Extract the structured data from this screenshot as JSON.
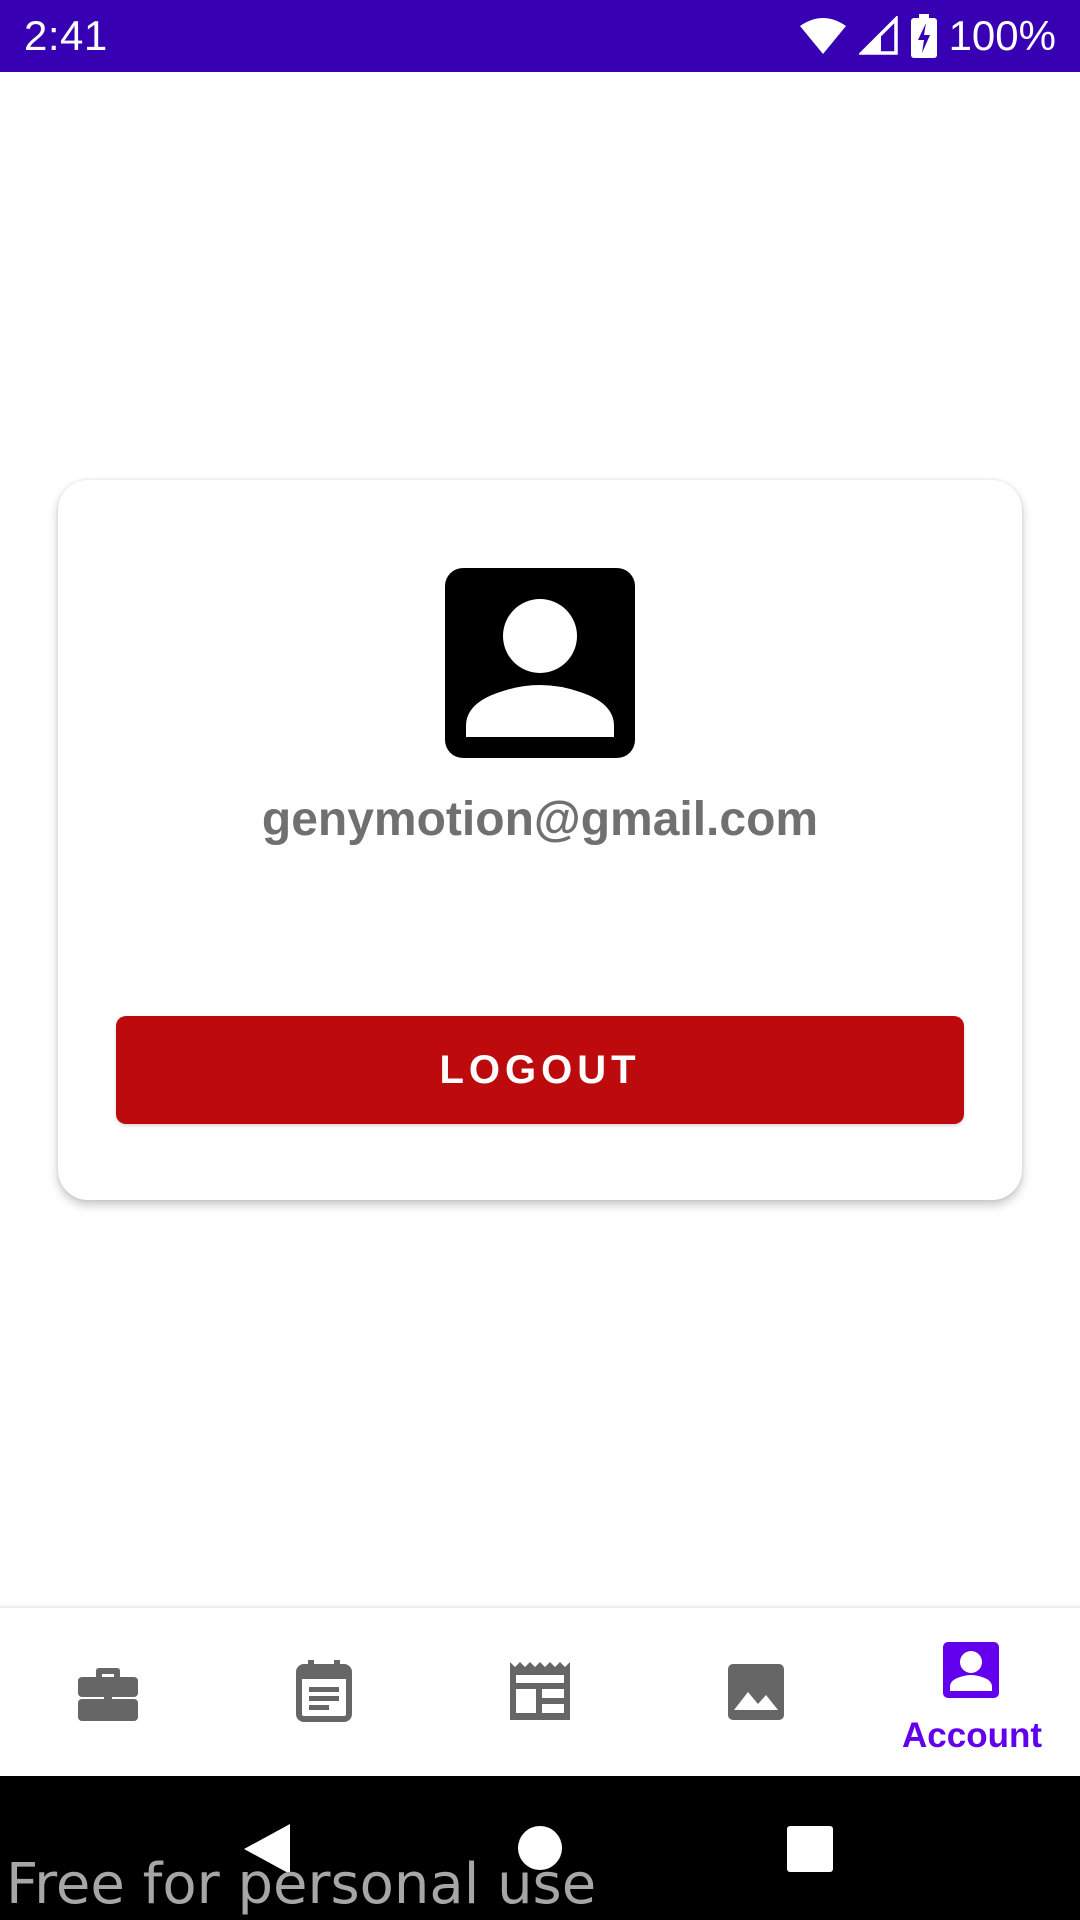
{
  "status_bar": {
    "time": "2:41",
    "battery": "100%",
    "background_color": "#3700b3",
    "icons": [
      "wifi-icon",
      "cell-signal-icon",
      "battery-charging-icon"
    ]
  },
  "account": {
    "email": "genymotion@gmail.com",
    "logout_label": "LOGOUT",
    "logout_color": "#bd0a0d",
    "avatar_icon": "account-box-icon"
  },
  "bottom_nav": {
    "items": [
      {
        "icon": "briefcase-icon",
        "label": "",
        "active": false
      },
      {
        "icon": "calendar-note-icon",
        "label": "",
        "active": false
      },
      {
        "icon": "newspaper-icon",
        "label": "",
        "active": false
      },
      {
        "icon": "image-icon",
        "label": "",
        "active": false
      },
      {
        "icon": "account-box-icon",
        "label": "Account",
        "active": true
      }
    ],
    "active_color": "#6200ee",
    "inactive_color": "#666666"
  },
  "system_nav": {
    "buttons": [
      "back-triangle-icon",
      "home-circle-icon",
      "recents-square-icon"
    ]
  },
  "watermark": "Free for personal use"
}
